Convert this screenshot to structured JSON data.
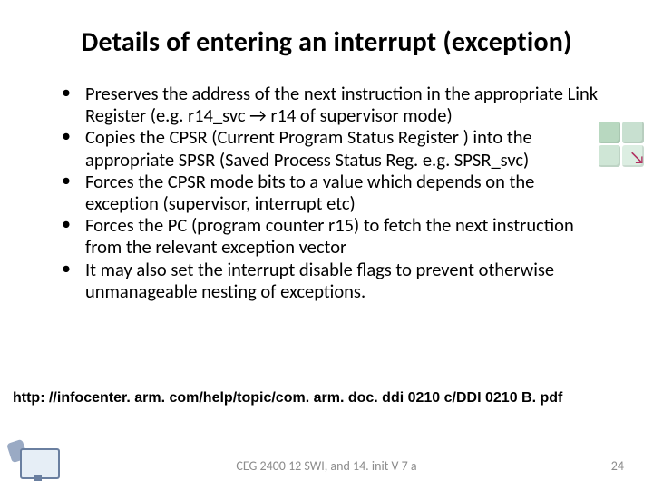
{
  "title": "Details of entering an interrupt (exception)",
  "bullets": [
    "Preserves the address of the next instruction in the appropriate Link Register (e.g. r14_svc → r14 of supervisor mode)",
    "Copies the CPSR (Current Program Status Register ) into the appropriate SPSR (Saved Process Status Reg. e.g. SPSR_svc)",
    "Forces the CPSR mode bits to a value which depends on the exception (supervisor, interrupt etc)",
    "Forces the PC (program counter r15) to fetch the next instruction from the relevant exception vector",
    "It may also set the interrupt disable flags to prevent otherwise unmanageable nesting of exceptions."
  ],
  "url": "http: //infocenter. arm. com/help/topic/com. arm. doc. ddi 0210 c/DDI 0210 B. pdf",
  "footer_center": "CEG 2400 12 SWI, and 14. init V 7 a",
  "footer_right": "24"
}
